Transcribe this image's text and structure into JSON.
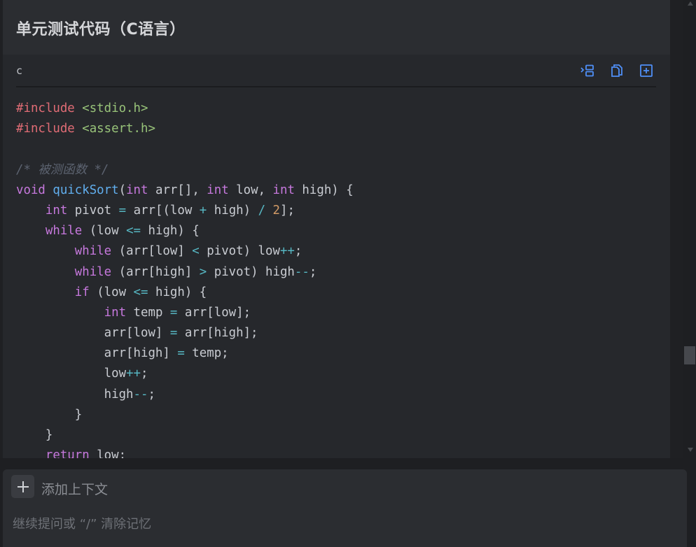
{
  "heading": "单元测试代码（C语言）",
  "code_block": {
    "language": "c",
    "tools": [
      "insert-code-icon",
      "copy-icon",
      "add-file-icon"
    ],
    "lines": [
      [
        [
          "t-pre",
          "#include "
        ],
        [
          "t-str",
          "<stdio.h>"
        ]
      ],
      [
        [
          "t-pre",
          "#include "
        ],
        [
          "t-str",
          "<assert.h>"
        ]
      ],
      [],
      [
        [
          "t-com",
          "/* 被测函数 */"
        ]
      ],
      [
        [
          "t-kw",
          "void "
        ],
        [
          "t-fn",
          "quickSort"
        ],
        [
          "t-txt",
          "("
        ],
        [
          "t-kw",
          "int"
        ],
        [
          "t-txt",
          " arr[], "
        ],
        [
          "t-kw",
          "int"
        ],
        [
          "t-txt",
          " low, "
        ],
        [
          "t-kw",
          "int"
        ],
        [
          "t-txt",
          " high) {"
        ]
      ],
      [
        [
          "t-txt",
          "    "
        ],
        [
          "t-kw",
          "int"
        ],
        [
          "t-txt",
          " pivot "
        ],
        [
          "t-op",
          "="
        ],
        [
          "t-txt",
          " arr[(low "
        ],
        [
          "t-op",
          "+"
        ],
        [
          "t-txt",
          " high) "
        ],
        [
          "t-op",
          "/"
        ],
        [
          "t-txt",
          " "
        ],
        [
          "t-num",
          "2"
        ],
        [
          "t-txt",
          "];"
        ]
      ],
      [
        [
          "t-txt",
          "    "
        ],
        [
          "t-kw",
          "while"
        ],
        [
          "t-txt",
          " (low "
        ],
        [
          "t-op",
          "<="
        ],
        [
          "t-txt",
          " high) {"
        ]
      ],
      [
        [
          "t-txt",
          "        "
        ],
        [
          "t-kw",
          "while"
        ],
        [
          "t-txt",
          " (arr[low] "
        ],
        [
          "t-op",
          "<"
        ],
        [
          "t-txt",
          " pivot) low"
        ],
        [
          "t-op",
          "++"
        ],
        [
          "t-txt",
          ";"
        ]
      ],
      [
        [
          "t-txt",
          "        "
        ],
        [
          "t-kw",
          "while"
        ],
        [
          "t-txt",
          " (arr[high] "
        ],
        [
          "t-op",
          ">"
        ],
        [
          "t-txt",
          " pivot) high"
        ],
        [
          "t-op",
          "--"
        ],
        [
          "t-txt",
          ";"
        ]
      ],
      [
        [
          "t-txt",
          "        "
        ],
        [
          "t-kw",
          "if"
        ],
        [
          "t-txt",
          " (low "
        ],
        [
          "t-op",
          "<="
        ],
        [
          "t-txt",
          " high) {"
        ]
      ],
      [
        [
          "t-txt",
          "            "
        ],
        [
          "t-kw",
          "int"
        ],
        [
          "t-txt",
          " temp "
        ],
        [
          "t-op",
          "="
        ],
        [
          "t-txt",
          " arr[low];"
        ]
      ],
      [
        [
          "t-txt",
          "            arr[low] "
        ],
        [
          "t-op",
          "="
        ],
        [
          "t-txt",
          " arr[high];"
        ]
      ],
      [
        [
          "t-txt",
          "            arr[high] "
        ],
        [
          "t-op",
          "="
        ],
        [
          "t-txt",
          " temp;"
        ]
      ],
      [
        [
          "t-txt",
          "            low"
        ],
        [
          "t-op",
          "++"
        ],
        [
          "t-txt",
          ";"
        ]
      ],
      [
        [
          "t-txt",
          "            high"
        ],
        [
          "t-op",
          "--"
        ],
        [
          "t-txt",
          ";"
        ]
      ],
      [
        [
          "t-txt",
          "        }"
        ]
      ],
      [
        [
          "t-txt",
          "    }"
        ]
      ],
      [
        [
          "t-txt",
          "    "
        ],
        [
          "t-kw",
          "return"
        ],
        [
          "t-txt",
          " low;"
        ]
      ]
    ]
  },
  "input_area": {
    "add_context_label": "添加上下文",
    "placeholder": "继续提问或 “/” 清除记忆"
  },
  "colors": {
    "accent": "#4f8ff7",
    "keyword": "#c678dd",
    "function": "#61afef",
    "string": "#98c379",
    "preprocessor": "#e06c75",
    "number": "#d19a66",
    "comment": "#5c6370"
  }
}
